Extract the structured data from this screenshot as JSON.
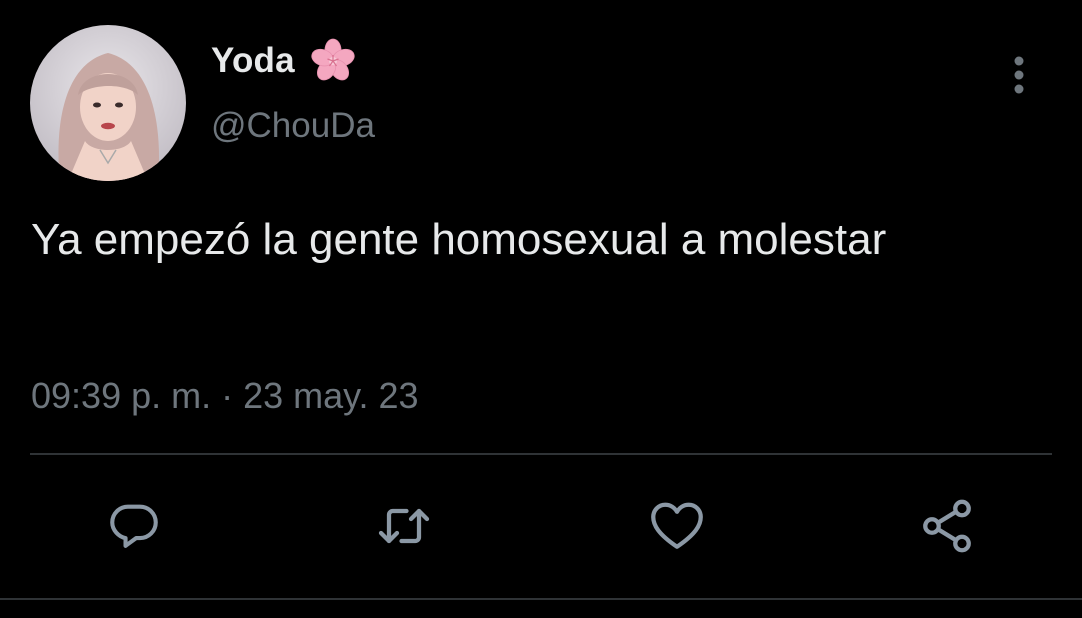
{
  "tweet": {
    "author": {
      "display_name": "Yoda",
      "handle": "@ChouDa",
      "name_emoji": "cherry-blossom-icon"
    },
    "text": "Ya empezó la gente homosexual a molestar",
    "timestamp": "09:39 p. m. · 23 may. 23"
  },
  "actions": [
    {
      "name": "reply",
      "icon": "reply-icon"
    },
    {
      "name": "retweet",
      "icon": "retweet-icon"
    },
    {
      "name": "like",
      "icon": "heart-icon"
    },
    {
      "name": "share",
      "icon": "share-icon"
    }
  ],
  "colors": {
    "background": "#000000",
    "primary_text": "#e7e9ea",
    "secondary_text": "#6e767d",
    "divider": "#2f3336",
    "flower_pink": "#f4a7c0"
  }
}
